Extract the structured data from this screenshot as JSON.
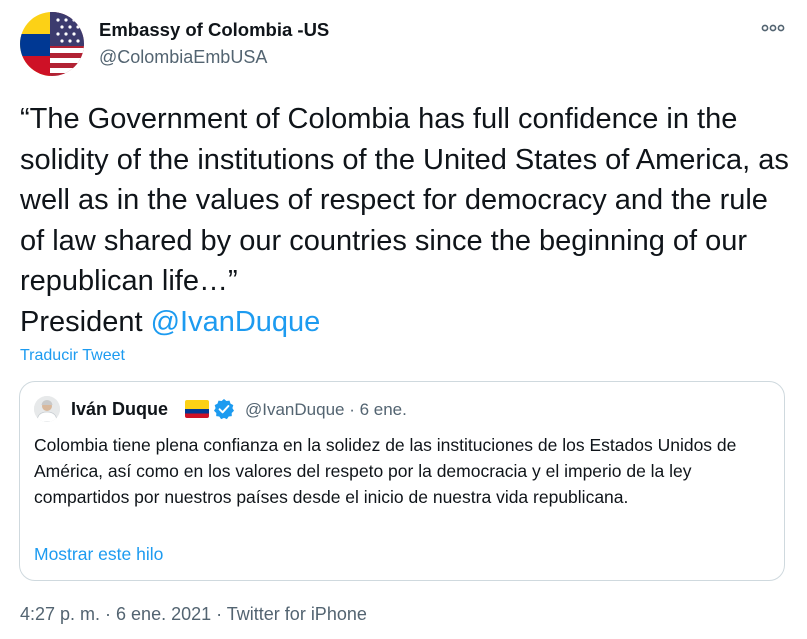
{
  "author": {
    "name": "Embassy of Colombia -US",
    "handle": "@ColombiaEmbUSA"
  },
  "tweet": {
    "text": "“The Government of Colombia has full confidence in the solidity of the institutions of the United States of America, as well as in the values of respect for democracy and the rule of law shared by our countries since the beginning of our republican life…”\nPresident ",
    "mention": "@IvanDuque",
    "translate_label": "Traducir Tweet"
  },
  "quoted_tweet": {
    "name": "Iván Duque",
    "handle_date": "@IvanDuque · 6 ene.",
    "text": "Colombia tiene plena confianza en la solidez de las instituciones de los Estados Unidos de América, así como en los valores del respeto por la democracia y el imperio de la ley compartidos por nuestros países desde el inicio de nuestra vida republicana.",
    "show_thread_label": "Mostrar este hilo"
  },
  "meta": {
    "timestamp_source": "4:27 p. m. · 6 ene. 2021 · Twitter for iPhone"
  },
  "icons": {
    "more": "more-icon",
    "verified": "verified-badge-icon",
    "flag": "colombia-flag-icon"
  },
  "colors": {
    "link": "#1d9bf0",
    "secondary_text": "#536471",
    "border": "#cfd9de"
  }
}
